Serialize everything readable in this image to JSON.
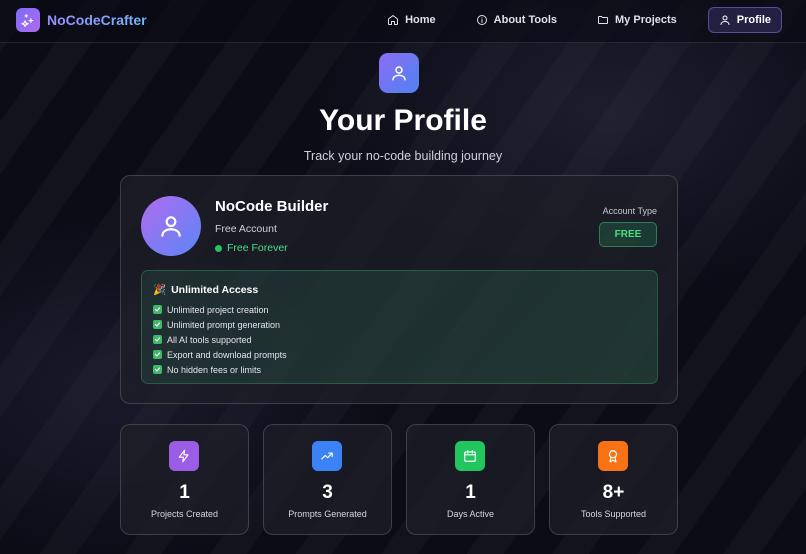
{
  "nav": {
    "brand": "NoCodeCrafter",
    "links": [
      {
        "label": "Home",
        "icon": "home-icon"
      },
      {
        "label": "About Tools",
        "icon": "info-icon"
      },
      {
        "label": "My Projects",
        "icon": "folder-icon"
      },
      {
        "label": "Profile",
        "icon": "user-icon",
        "active": true
      }
    ]
  },
  "header": {
    "title": "Your Profile",
    "subtitle": "Track your no-code building journey"
  },
  "profile": {
    "name": "NoCode Builder",
    "plan": "Free Account",
    "status": "Free Forever",
    "account_type_label": "Account Type",
    "account_type": "FREE"
  },
  "access": {
    "title": "Unlimited Access",
    "icon": "party-popper-icon",
    "items": [
      "Unlimited project creation",
      "Unlimited prompt generation",
      "All AI tools supported",
      "Export and download prompts",
      "No hidden fees or limits"
    ]
  },
  "stats": [
    {
      "value": "1",
      "label": "Projects Created",
      "icon": "lightning-icon",
      "color": "#9b5de5"
    },
    {
      "value": "3",
      "label": "Prompts Generated",
      "icon": "trending-up-icon",
      "color": "#3b82f6"
    },
    {
      "value": "1",
      "label": "Days Active",
      "icon": "calendar-icon",
      "color": "#22c55e"
    },
    {
      "value": "8+",
      "label": "Tools Supported",
      "icon": "award-icon",
      "color": "#f97316"
    }
  ],
  "colors": {
    "accent": "#7b6cf6",
    "success": "#4ade80",
    "background": "#0d0d18"
  }
}
